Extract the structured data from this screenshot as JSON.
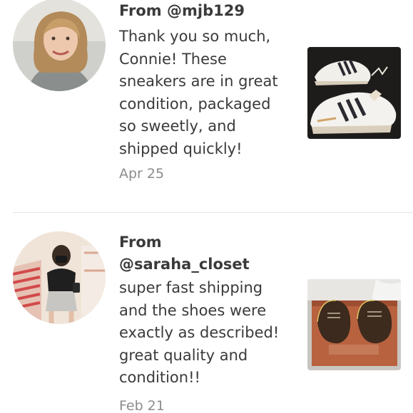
{
  "reviews": [
    {
      "from_label": "From",
      "handle": "@mjb129",
      "comment_lines": [
        "Thank you so much,",
        "Connie! These",
        "sneakers are in great",
        "condition, packaged",
        "so sweetly, and",
        "shipped quickly!"
      ],
      "date": "Apr 25"
    },
    {
      "from_label": "From",
      "handle": "@saraha_closet",
      "comment_lines": [
        "super fast shipping",
        "and the shoes were",
        "exactly as described!",
        "great quality and",
        "condition!!"
      ],
      "date": "Feb 21"
    }
  ],
  "colors": {
    "text": "#3a3a3a",
    "muted": "#8c8c8c",
    "divider": "#e6e6e6"
  }
}
